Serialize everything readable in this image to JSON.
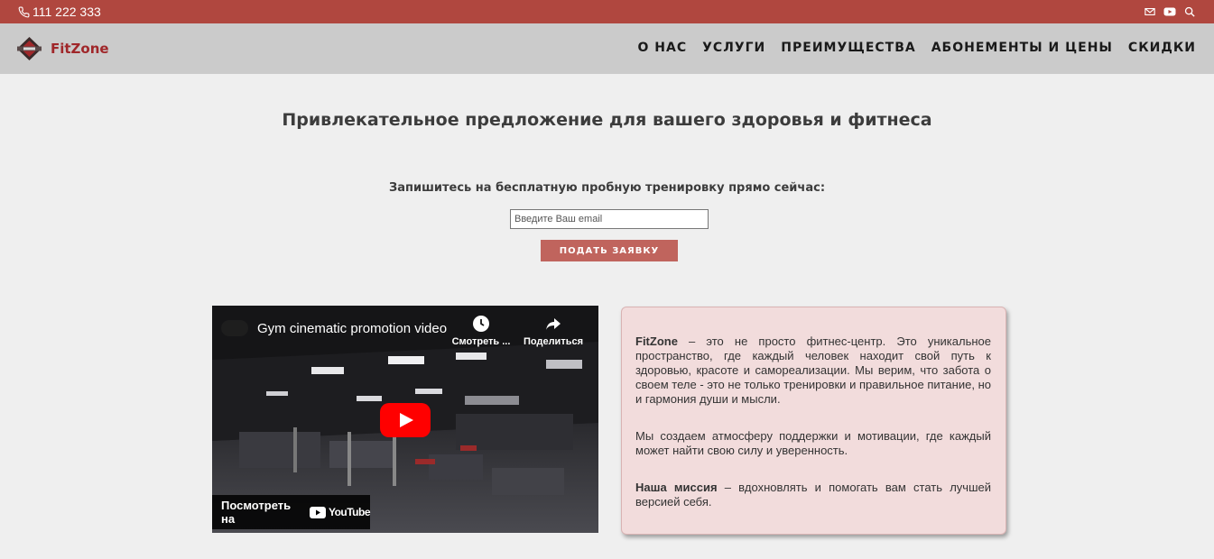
{
  "topbar": {
    "phone": "111 222 333",
    "icons": [
      "phone-icon",
      "mail-icon",
      "youtube-icon",
      "search-icon"
    ]
  },
  "header": {
    "brand": "FitZone",
    "nav": [
      "О НАС",
      "УСЛУГИ",
      "ПРЕИМУЩЕСТВА",
      "АБОНЕМЕНТЫ И ЦЕНЫ",
      "СКИДКИ"
    ]
  },
  "main": {
    "heading": "Привлекательное предложение для вашего здоровья и фитнеса",
    "subheading": "Запишитесь на бесплатную пробную тренировку прямо сейчас:",
    "email_placeholder": "Введите Ваш email",
    "submit_label": "ПОДАТЬ ЗАЯВКУ"
  },
  "video": {
    "title": "Gym cinematic promotion video",
    "watch_later": "Смотреть ...",
    "share": "Поделиться",
    "watch_on": "Посмотреть на",
    "platform": "YouTube"
  },
  "about": {
    "p1_brand": "FitZone",
    "p1_text": " – это не просто фитнес-центр. Это уникальное пространство, где каждый человек находит свой путь к здоровью, красоте и самореализации. Мы верим, что забота о своем теле - это не только тренировки и правильное питание, но и гармония души и мысли.",
    "p2_text": "Мы создаем атмосферу поддержки и мотивации, где каждый может найти свою силу и уверенность.",
    "p3_label": "Наша миссия",
    "p3_text": " – вдохновлять и помогать вам стать лучшей версией себя."
  },
  "colors": {
    "topbar": "#b0473f",
    "navbar": "#cbcbcb",
    "brand": "#a0272a",
    "button": "#c0645d",
    "card": "#f2dcdc"
  }
}
